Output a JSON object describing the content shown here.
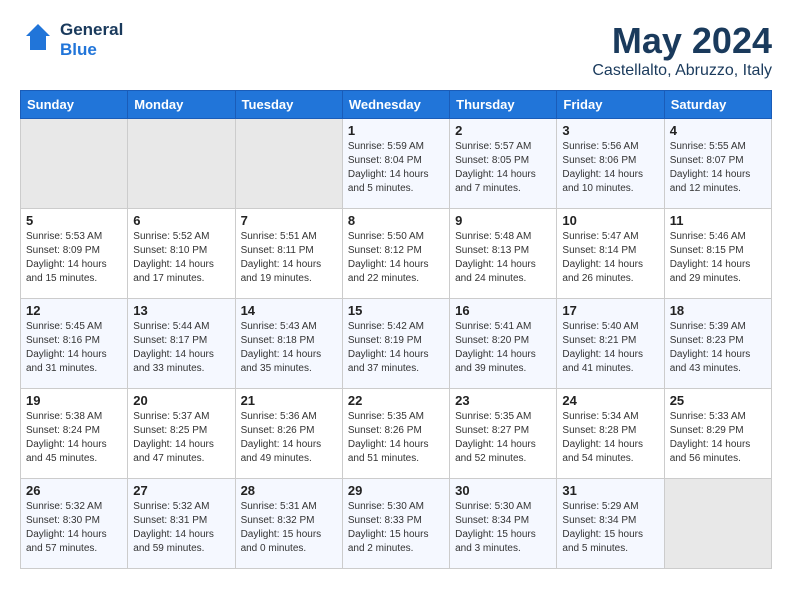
{
  "header": {
    "logo_line1": "General",
    "logo_line2": "Blue",
    "month": "May 2024",
    "location": "Castellalto, Abruzzo, Italy"
  },
  "weekdays": [
    "Sunday",
    "Monday",
    "Tuesday",
    "Wednesday",
    "Thursday",
    "Friday",
    "Saturday"
  ],
  "weeks": [
    [
      {
        "day": "",
        "info": ""
      },
      {
        "day": "",
        "info": ""
      },
      {
        "day": "",
        "info": ""
      },
      {
        "day": "1",
        "info": "Sunrise: 5:59 AM\nSunset: 8:04 PM\nDaylight: 14 hours\nand 5 minutes."
      },
      {
        "day": "2",
        "info": "Sunrise: 5:57 AM\nSunset: 8:05 PM\nDaylight: 14 hours\nand 7 minutes."
      },
      {
        "day": "3",
        "info": "Sunrise: 5:56 AM\nSunset: 8:06 PM\nDaylight: 14 hours\nand 10 minutes."
      },
      {
        "day": "4",
        "info": "Sunrise: 5:55 AM\nSunset: 8:07 PM\nDaylight: 14 hours\nand 12 minutes."
      }
    ],
    [
      {
        "day": "5",
        "info": "Sunrise: 5:53 AM\nSunset: 8:09 PM\nDaylight: 14 hours\nand 15 minutes."
      },
      {
        "day": "6",
        "info": "Sunrise: 5:52 AM\nSunset: 8:10 PM\nDaylight: 14 hours\nand 17 minutes."
      },
      {
        "day": "7",
        "info": "Sunrise: 5:51 AM\nSunset: 8:11 PM\nDaylight: 14 hours\nand 19 minutes."
      },
      {
        "day": "8",
        "info": "Sunrise: 5:50 AM\nSunset: 8:12 PM\nDaylight: 14 hours\nand 22 minutes."
      },
      {
        "day": "9",
        "info": "Sunrise: 5:48 AM\nSunset: 8:13 PM\nDaylight: 14 hours\nand 24 minutes."
      },
      {
        "day": "10",
        "info": "Sunrise: 5:47 AM\nSunset: 8:14 PM\nDaylight: 14 hours\nand 26 minutes."
      },
      {
        "day": "11",
        "info": "Sunrise: 5:46 AM\nSunset: 8:15 PM\nDaylight: 14 hours\nand 29 minutes."
      }
    ],
    [
      {
        "day": "12",
        "info": "Sunrise: 5:45 AM\nSunset: 8:16 PM\nDaylight: 14 hours\nand 31 minutes."
      },
      {
        "day": "13",
        "info": "Sunrise: 5:44 AM\nSunset: 8:17 PM\nDaylight: 14 hours\nand 33 minutes."
      },
      {
        "day": "14",
        "info": "Sunrise: 5:43 AM\nSunset: 8:18 PM\nDaylight: 14 hours\nand 35 minutes."
      },
      {
        "day": "15",
        "info": "Sunrise: 5:42 AM\nSunset: 8:19 PM\nDaylight: 14 hours\nand 37 minutes."
      },
      {
        "day": "16",
        "info": "Sunrise: 5:41 AM\nSunset: 8:20 PM\nDaylight: 14 hours\nand 39 minutes."
      },
      {
        "day": "17",
        "info": "Sunrise: 5:40 AM\nSunset: 8:21 PM\nDaylight: 14 hours\nand 41 minutes."
      },
      {
        "day": "18",
        "info": "Sunrise: 5:39 AM\nSunset: 8:23 PM\nDaylight: 14 hours\nand 43 minutes."
      }
    ],
    [
      {
        "day": "19",
        "info": "Sunrise: 5:38 AM\nSunset: 8:24 PM\nDaylight: 14 hours\nand 45 minutes."
      },
      {
        "day": "20",
        "info": "Sunrise: 5:37 AM\nSunset: 8:25 PM\nDaylight: 14 hours\nand 47 minutes."
      },
      {
        "day": "21",
        "info": "Sunrise: 5:36 AM\nSunset: 8:26 PM\nDaylight: 14 hours\nand 49 minutes."
      },
      {
        "day": "22",
        "info": "Sunrise: 5:35 AM\nSunset: 8:26 PM\nDaylight: 14 hours\nand 51 minutes."
      },
      {
        "day": "23",
        "info": "Sunrise: 5:35 AM\nSunset: 8:27 PM\nDaylight: 14 hours\nand 52 minutes."
      },
      {
        "day": "24",
        "info": "Sunrise: 5:34 AM\nSunset: 8:28 PM\nDaylight: 14 hours\nand 54 minutes."
      },
      {
        "day": "25",
        "info": "Sunrise: 5:33 AM\nSunset: 8:29 PM\nDaylight: 14 hours\nand 56 minutes."
      }
    ],
    [
      {
        "day": "26",
        "info": "Sunrise: 5:32 AM\nSunset: 8:30 PM\nDaylight: 14 hours\nand 57 minutes."
      },
      {
        "day": "27",
        "info": "Sunrise: 5:32 AM\nSunset: 8:31 PM\nDaylight: 14 hours\nand 59 minutes."
      },
      {
        "day": "28",
        "info": "Sunrise: 5:31 AM\nSunset: 8:32 PM\nDaylight: 15 hours\nand 0 minutes."
      },
      {
        "day": "29",
        "info": "Sunrise: 5:30 AM\nSunset: 8:33 PM\nDaylight: 15 hours\nand 2 minutes."
      },
      {
        "day": "30",
        "info": "Sunrise: 5:30 AM\nSunset: 8:34 PM\nDaylight: 15 hours\nand 3 minutes."
      },
      {
        "day": "31",
        "info": "Sunrise: 5:29 AM\nSunset: 8:34 PM\nDaylight: 15 hours\nand 5 minutes."
      },
      {
        "day": "",
        "info": ""
      }
    ]
  ]
}
